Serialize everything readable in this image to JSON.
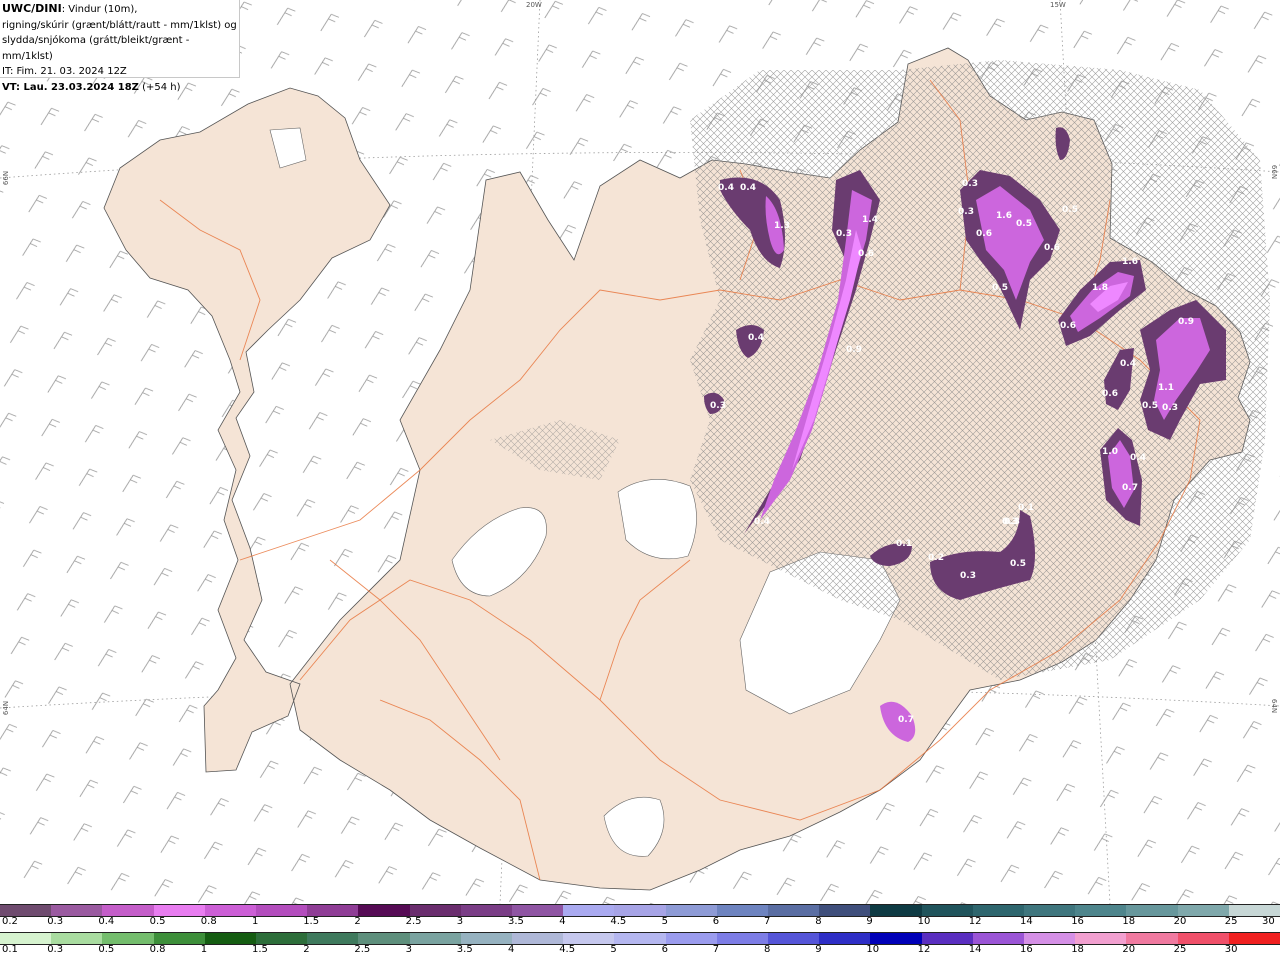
{
  "header": {
    "model": "UWC/DINI",
    "line1_rest": ": Vindur (10m),",
    "line2": "rigning/skúrir (grænt/blátt/rautt - mm/1klst) og",
    "line3": "slydda/snjókoma (grátt/bleikt/grænt - mm/1klst)",
    "it_line": "IT: Fim. 21. 03. 2024 12Z",
    "vt_label": "VT: Lau. 23.03.2024 18Z",
    "vt_rest": " (+54 h)"
  },
  "grid_labels": {
    "top_20w": "20W",
    "top_15w": "15W",
    "left_66n": "66N",
    "right_66n": "66N",
    "left_64n": "64N",
    "right_64n": "64N"
  },
  "map_colors": {
    "sea": "#ffffff",
    "land": "#f5e4d6",
    "glacier": "#ffffff",
    "roads": "#e8763e",
    "snow_light": "#b070c8",
    "snow_mid": "#cc66dd",
    "snow_strong": "#ee88ff",
    "snow_dark": "#6a3c70",
    "wind_barb": "#888888"
  },
  "precip_labels": [
    "0.4",
    "0.4",
    "1.4",
    "0.3",
    "0.6",
    "1.3",
    "0.3",
    "1.6",
    "0.5",
    "0.5",
    "0.6",
    "0.5",
    "1.8",
    "1.6",
    "0.6",
    "0.4",
    "0.3",
    "0.9",
    "0.3",
    "0.9",
    "1.1",
    "0.4",
    "0.6",
    "0.5",
    "0.3",
    "0.3",
    "0.6",
    "1.0",
    "0.4",
    "0.7",
    "0.4",
    "0.3",
    "0.1",
    "0.2",
    "0.3",
    "0.5",
    "0.1",
    "0.7"
  ],
  "scale_snow": {
    "ticks": [
      "0.2",
      "0.3",
      "0.4",
      "0.5",
      "0.8",
      "1",
      "1.5",
      "2",
      "2.5",
      "3",
      "3.5",
      "4",
      "4.5",
      "5",
      "6",
      "7",
      "8",
      "9",
      "10",
      "12",
      "14",
      "16",
      "18",
      "20",
      "25",
      "30"
    ],
    "colors": [
      "#6f4b6f",
      "#9a5aa0",
      "#c45ec9",
      "#e87df0",
      "#cc5fd6",
      "#b34dbd",
      "#8f3d96",
      "#560b55",
      "#6a2d6e",
      "#7a3d86",
      "#8f55a3",
      "#aaaaf0",
      "#a7a4e6",
      "#8e9bd6",
      "#6e84c0",
      "#5a6ea3",
      "#3f4f7c",
      "#0f3b44",
      "#20545c",
      "#2e666e",
      "#3f767e",
      "#4e858c",
      "#67979c",
      "#7fa8ab",
      "#c7d7d6"
    ]
  },
  "scale_rain": {
    "ticks": [
      "0.1",
      "0.3",
      "0.5",
      "0.8",
      "1",
      "1.5",
      "2",
      "2.5",
      "3",
      "3.5",
      "4",
      "4.5",
      "5",
      "6",
      "7",
      "8",
      "9",
      "10",
      "12",
      "14",
      "16",
      "18",
      "20",
      "25",
      "30"
    ],
    "colors": [
      "#d6f3cf",
      "#a9dca0",
      "#74bd6d",
      "#3d8f3a",
      "#155d12",
      "#2d6e3a",
      "#3f7a5d",
      "#5e8f7c",
      "#7aa3a0",
      "#96b2c0",
      "#afb8d8",
      "#c6c8ee",
      "#b5b7f0",
      "#9b9cee",
      "#7d7de6",
      "#5555d8",
      "#2e2ec6",
      "#0000b8",
      "#5a2ec0",
      "#9b55d6",
      "#d590e6",
      "#f2a0d0",
      "#f07aa0",
      "#f0506a",
      "#f02020"
    ]
  }
}
